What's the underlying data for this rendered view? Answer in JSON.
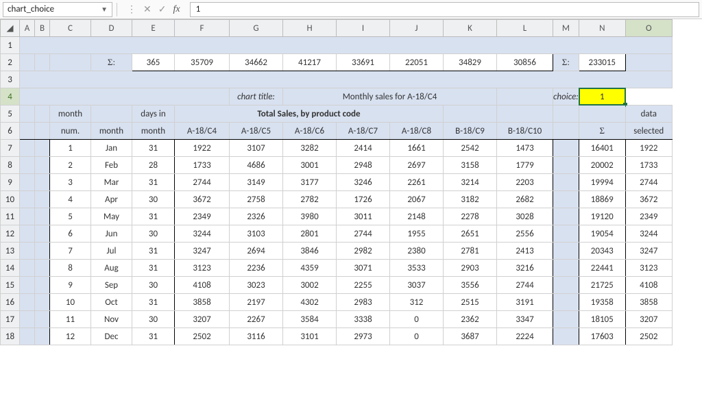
{
  "namebox": "chart_choice",
  "formula_value": "1",
  "colLetters": [
    "A",
    "B",
    "C",
    "D",
    "E",
    "F",
    "G",
    "H",
    "I",
    "J",
    "K",
    "L",
    "M",
    "N",
    "O"
  ],
  "rowNums": [
    "1",
    "2",
    "3",
    "4",
    "5",
    "6",
    "7",
    "8",
    "9",
    "10",
    "11",
    "12",
    "13",
    "14",
    "15",
    "16",
    "17",
    "18"
  ],
  "sigma": "Σ:",
  "sigmaPlain": "Σ",
  "sumRow": {
    "E": "365",
    "F": "35709",
    "G": "34662",
    "H": "41217",
    "I": "33691",
    "J": "22051",
    "K": "34829",
    "L": "30856",
    "N": "233015"
  },
  "chartTitleLabel": "chart title:",
  "chartTitle": "Monthly sales for A-18/C4",
  "choiceLabel": "choice:",
  "choiceValue": "1",
  "tableTitle": "Total Sales, by product code",
  "hdr": {
    "monthNumTop": "month",
    "monthNumBot": "num.",
    "month": "month",
    "daysTop": "days in",
    "daysBot": "month",
    "F": "A-18/C4",
    "G": "A-18/C5",
    "H": "A-18/C6",
    "I": "A-18/C7",
    "J": "A-18/C8",
    "K": "B-18/C9",
    "L": "B-18/C10",
    "dataTop": "data",
    "dataBot": "selected"
  },
  "chart_data": {
    "type": "table",
    "title": "Total Sales, by product code",
    "columns": [
      "month num.",
      "month",
      "days in month",
      "A-18/C4",
      "A-18/C5",
      "A-18/C6",
      "A-18/C7",
      "A-18/C8",
      "B-18/C9",
      "B-18/C10",
      "Σ",
      "data selected"
    ],
    "rows": [
      [
        1,
        "Jan",
        31,
        1922,
        3107,
        3282,
        2414,
        1661,
        2542,
        1473,
        16401,
        1922
      ],
      [
        2,
        "Feb",
        28,
        1733,
        4686,
        3001,
        2948,
        2697,
        3158,
        1779,
        20002,
        1733
      ],
      [
        3,
        "Mar",
        31,
        2744,
        3149,
        3177,
        3246,
        2261,
        3214,
        2203,
        19994,
        2744
      ],
      [
        4,
        "Apr",
        30,
        3672,
        2758,
        2782,
        1726,
        2067,
        3182,
        2682,
        18869,
        3672
      ],
      [
        5,
        "May",
        31,
        2349,
        2326,
        3980,
        3011,
        2148,
        2278,
        3028,
        19120,
        2349
      ],
      [
        6,
        "Jun",
        30,
        3244,
        3103,
        2801,
        2744,
        1955,
        2651,
        2556,
        19054,
        3244
      ],
      [
        7,
        "Jul",
        31,
        3247,
        2694,
        3846,
        2982,
        2380,
        2781,
        2413,
        20343,
        3247
      ],
      [
        8,
        "Aug",
        31,
        3123,
        2236,
        4359,
        3071,
        3533,
        2903,
        3216,
        22441,
        3123
      ],
      [
        9,
        "Sep",
        30,
        4108,
        3023,
        3002,
        2255,
        3037,
        3556,
        2744,
        21725,
        4108
      ],
      [
        10,
        "Oct",
        31,
        3858,
        2197,
        4302,
        2983,
        312,
        2515,
        3191,
        19358,
        3858
      ],
      [
        11,
        "Nov",
        30,
        3207,
        2267,
        3584,
        3338,
        0,
        2362,
        3347,
        18105,
        3207
      ],
      [
        12,
        "Dec",
        31,
        2502,
        3116,
        3101,
        2973,
        0,
        3687,
        2224,
        17603,
        2502
      ]
    ],
    "column_sums": {
      "days": 365,
      "A-18/C4": 35709,
      "A-18/C5": 34662,
      "A-18/C6": 41217,
      "A-18/C7": 33691,
      "A-18/C8": 22051,
      "B-18/C9": 34829,
      "B-18/C10": 30856,
      "grand_total": 233015
    }
  }
}
